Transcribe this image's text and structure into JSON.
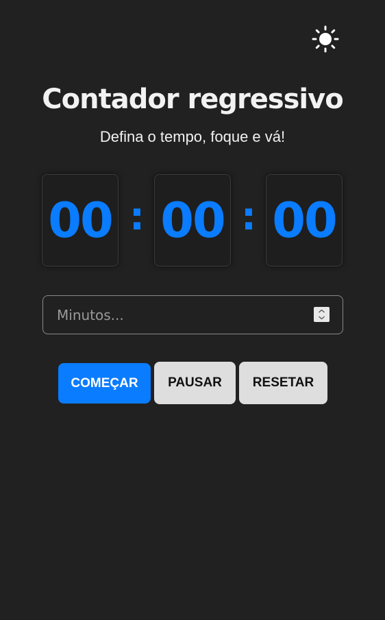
{
  "header": {
    "theme_icon": "sun-icon",
    "title": "Contador regressivo",
    "subtitle": "Defina o tempo, foque e vá!"
  },
  "timer": {
    "hours": "00",
    "minutes": "00",
    "seconds": "00",
    "separator": ":",
    "digit_color": "#0a7cff"
  },
  "input": {
    "placeholder": "Minutos...",
    "value": "",
    "spinner_icon": "spinner-icon"
  },
  "buttons": {
    "start_label": "COMEÇAR",
    "pause_label": "PAUSAR",
    "reset_label": "RESETAR"
  },
  "colors": {
    "background": "#212121",
    "accent": "#0a7cff",
    "secondary_button": "#dedede"
  }
}
